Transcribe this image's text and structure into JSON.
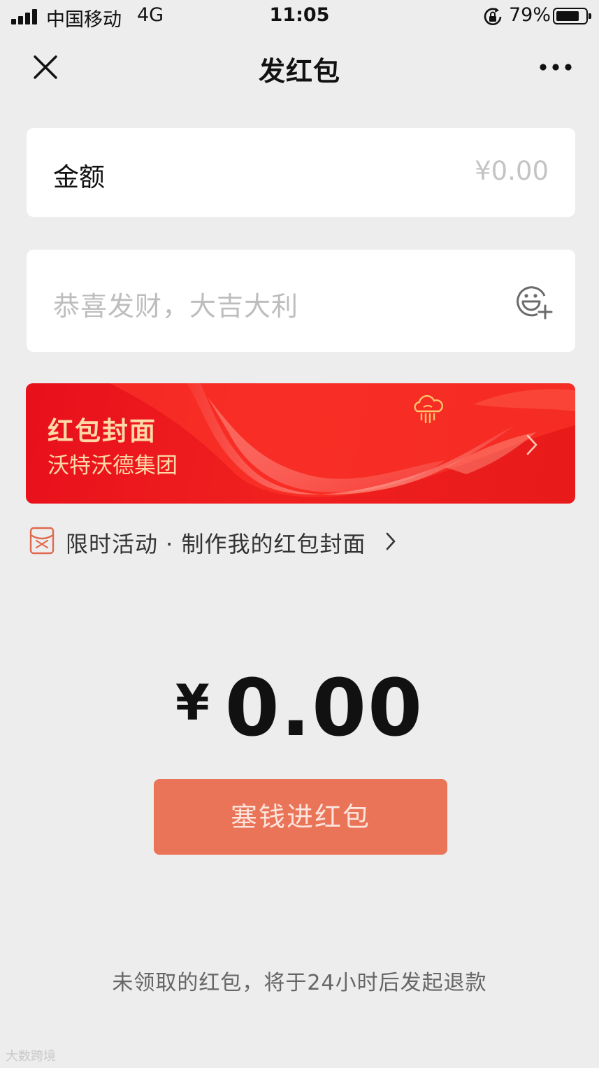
{
  "status_bar": {
    "carrier": "中国移动",
    "network": "4G",
    "time": "11:05",
    "battery_percent": "79%",
    "battery_level": 0.79,
    "signal_bars": 4
  },
  "nav": {
    "title": "发红包",
    "close_icon": "close-icon",
    "more_icon": "more-icon"
  },
  "amount": {
    "label": "金额",
    "placeholder": "¥0.00"
  },
  "greeting": {
    "placeholder": "恭喜发财，大吉大利",
    "emoji_icon": "emoji-add-icon"
  },
  "cover": {
    "title": "红包封面",
    "subtitle": "沃特沃德集团"
  },
  "promo": {
    "text": "限时活动 · 制作我的红包封面"
  },
  "total": {
    "currency": "¥",
    "amount": "0.00"
  },
  "submit": {
    "label": "塞钱进红包"
  },
  "refund_note": "未领取的红包，将于24小时后发起退款",
  "watermark": "大数跨境",
  "colors": {
    "background": "#ededed",
    "cover_red": "#e8101b",
    "cover_text": "#ffd9a8",
    "submit_bg": "#ea7458",
    "placeholder": "#c4c4c4"
  }
}
